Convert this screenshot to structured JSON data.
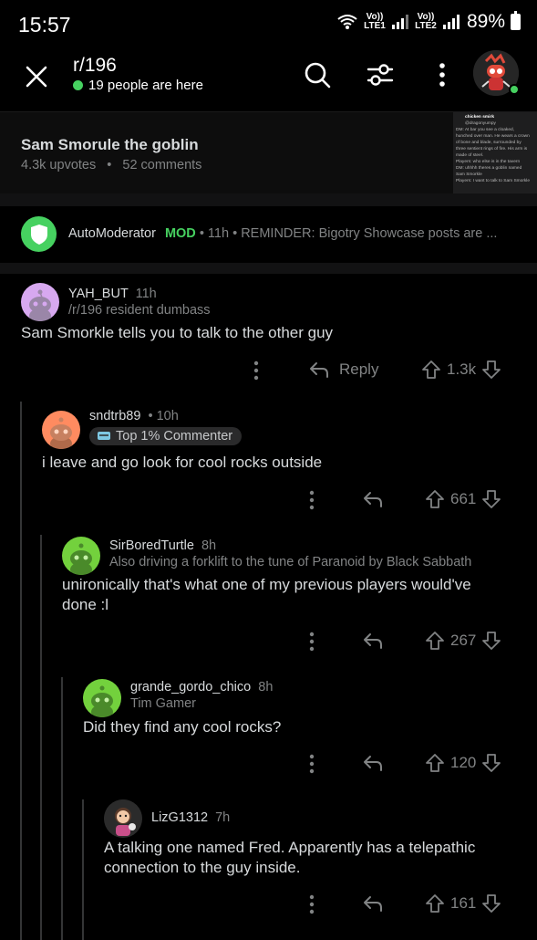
{
  "status_bar": {
    "time": "15:57",
    "battery": "89%",
    "sim1": "Vo)) LTE1",
    "sim2": "Vo)) LTE2"
  },
  "header": {
    "subreddit": "r/196",
    "online_text": "19 people are here"
  },
  "post": {
    "title": "Sam Smorule the goblin",
    "upvotes": "4.3k upvotes",
    "separator": "•",
    "comments": "52 comments",
    "thumb_lines": [
      "chicken smirk",
      "@dragonyumpy",
      "DM: At bar you see a cloaked,",
      "hunched over man. He wears a crown",
      "of bone and blade, surrounded by",
      "three sentient rings of fire. His arm is",
      "made of steel.",
      "Players: who else is in the tavern",
      "DM: uhhhh theres a goblin named",
      "Sam Smorkle",
      "Players: I want to talk to Sam Smorkle"
    ]
  },
  "automod": {
    "user": "AutoModerator",
    "badge": "MOD",
    "meta": " • 11h • ",
    "text": "REMINDER: Bigotry Showcase posts are ..."
  },
  "comments": [
    {
      "user": "YAH_BUT",
      "time": "11h",
      "flair": "/r/196 resident dumbass",
      "body": "Sam Smorkle tells you to talk to the other guy",
      "reply_label": "Reply",
      "votes": "1.3k"
    },
    {
      "user": "sndtrb89",
      "time": "• 10h",
      "flair": "Top 1% Commenter",
      "body": "i leave and go look for cool rocks outside",
      "votes": "661"
    },
    {
      "user": "SirBoredTurtle",
      "time": "8h",
      "flair": "Also driving a forklift to the tune of Paranoid by Black Sabbath",
      "body_line1": "unironically that's what one of my previous players would've",
      "body_line2": "done :l",
      "votes": "267"
    },
    {
      "user": "grande_gordo_chico",
      "time": "8h",
      "flair": "Tim Gamer",
      "body": "Did they find any cool rocks?",
      "votes": "120"
    },
    {
      "user": "LizG1312",
      "time": "7h",
      "body_line1": "A talking one named Fred. Apparently has a telepathic",
      "body_line2": "connection to the guy inside.",
      "votes": "161"
    }
  ],
  "colors": {
    "bg": "#000000",
    "online_green": "#46d160",
    "text": "#d7dadc",
    "meta": "#818384"
  }
}
